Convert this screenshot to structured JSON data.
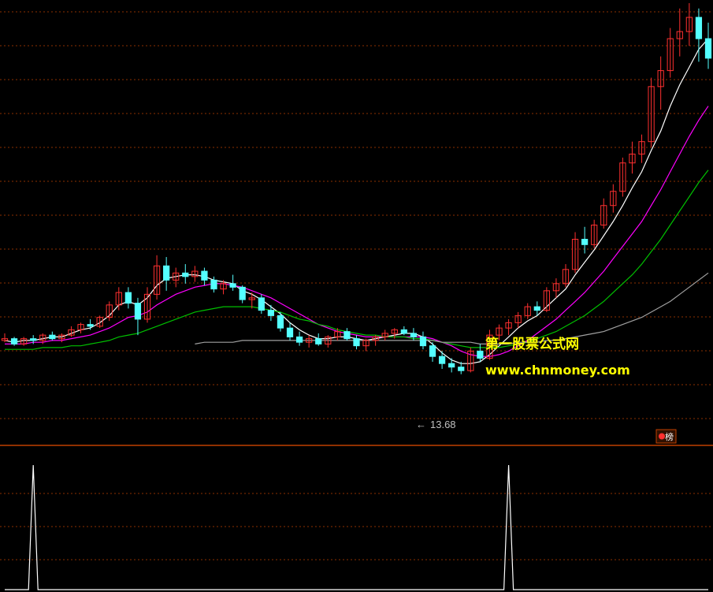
{
  "colors": {
    "background": "#000000",
    "grid": "#8b2f00",
    "divider": "#c04000",
    "up_candle": "#ff3030",
    "down_candle": "#54ffff",
    "ma_short": "#ffffff",
    "ma_mid": "#ff00ff",
    "ma_long": "#00c000",
    "ma_longest": "#a0a0a0",
    "indicator": "#ffffff",
    "watermark": "#ffff00"
  },
  "annotations": {
    "low_price": "13.68",
    "low_arrow": "←"
  },
  "watermark": {
    "line1": "第一股票公式网",
    "line2": "www.chnmoney.com"
  },
  "badge": {
    "icon": "list-badge-icon",
    "text": "榜"
  },
  "chart_data": [
    {
      "type": "candlestick",
      "panel": "main",
      "price_min_visible": 13.68,
      "candles": [
        [
          18.2,
          18.6,
          18.1,
          18.3
        ],
        [
          18.3,
          18.4,
          17.9,
          18.0
        ],
        [
          18.0,
          18.4,
          17.9,
          18.3
        ],
        [
          18.3,
          18.5,
          18.0,
          18.2
        ],
        [
          18.2,
          18.6,
          18.0,
          18.5
        ],
        [
          18.5,
          18.7,
          18.2,
          18.3
        ],
        [
          18.3,
          18.6,
          18.1,
          18.5
        ],
        [
          18.5,
          19.0,
          18.4,
          18.8
        ],
        [
          18.8,
          19.2,
          18.6,
          19.1
        ],
        [
          19.1,
          19.4,
          18.8,
          19.0
        ],
        [
          19.0,
          19.6,
          18.9,
          19.5
        ],
        [
          19.5,
          20.4,
          19.3,
          20.2
        ],
        [
          20.2,
          21.2,
          19.9,
          20.9
        ],
        [
          20.9,
          21.2,
          20.0,
          20.3
        ],
        [
          20.3,
          20.6,
          18.5,
          19.4
        ],
        [
          19.4,
          21.2,
          19.2,
          20.8
        ],
        [
          20.8,
          23.0,
          20.5,
          22.4
        ],
        [
          22.4,
          22.9,
          21.0,
          21.6
        ],
        [
          21.6,
          22.3,
          21.2,
          22.0
        ],
        [
          22.0,
          22.5,
          21.4,
          21.8
        ],
        [
          21.8,
          22.4,
          21.5,
          22.1
        ],
        [
          22.1,
          22.3,
          21.3,
          21.6
        ],
        [
          21.6,
          21.8,
          20.9,
          21.1
        ],
        [
          21.1,
          21.6,
          20.8,
          21.4
        ],
        [
          21.4,
          21.9,
          21.0,
          21.2
        ],
        [
          21.2,
          21.3,
          20.3,
          20.5
        ],
        [
          20.5,
          20.9,
          20.0,
          20.6
        ],
        [
          20.6,
          20.8,
          19.7,
          19.9
        ],
        [
          19.9,
          20.2,
          19.3,
          19.6
        ],
        [
          19.6,
          19.8,
          18.7,
          18.9
        ],
        [
          18.9,
          19.2,
          18.2,
          18.4
        ],
        [
          18.4,
          18.7,
          17.9,
          18.1
        ],
        [
          18.1,
          18.5,
          17.8,
          18.3
        ],
        [
          18.3,
          18.6,
          17.9,
          18.0
        ],
        [
          18.0,
          18.5,
          17.8,
          18.4
        ],
        [
          18.4,
          18.9,
          18.2,
          18.7
        ],
        [
          18.7,
          18.9,
          18.2,
          18.3
        ],
        [
          18.3,
          18.5,
          17.7,
          17.9
        ],
        [
          17.9,
          18.3,
          17.6,
          18.2
        ],
        [
          18.2,
          18.5,
          17.9,
          18.4
        ],
        [
          18.4,
          18.8,
          18.2,
          18.6
        ],
        [
          18.6,
          18.9,
          18.3,
          18.8
        ],
        [
          18.8,
          19.0,
          18.5,
          18.6
        ],
        [
          18.6,
          18.9,
          18.2,
          18.4
        ],
        [
          18.4,
          18.7,
          17.7,
          17.9
        ],
        [
          17.9,
          18.1,
          17.0,
          17.3
        ],
        [
          17.3,
          17.6,
          16.6,
          16.9
        ],
        [
          16.9,
          17.2,
          16.4,
          16.7
        ],
        [
          16.7,
          17.0,
          16.3,
          16.5
        ],
        [
          16.5,
          17.8,
          16.4,
          17.6
        ],
        [
          17.6,
          18.0,
          17.0,
          17.2
        ],
        [
          17.2,
          18.8,
          17.1,
          18.5
        ],
        [
          18.5,
          19.1,
          18.2,
          18.9
        ],
        [
          18.9,
          19.4,
          18.5,
          19.2
        ],
        [
          19.2,
          19.8,
          18.9,
          19.6
        ],
        [
          19.6,
          20.3,
          19.4,
          20.1
        ],
        [
          20.1,
          20.4,
          19.6,
          19.9
        ],
        [
          19.9,
          21.2,
          19.8,
          21.0
        ],
        [
          21.0,
          21.7,
          20.6,
          21.4
        ],
        [
          21.4,
          22.5,
          21.2,
          22.2
        ],
        [
          22.2,
          24.3,
          22.0,
          23.9
        ],
        [
          23.9,
          24.6,
          23.1,
          23.6
        ],
        [
          23.6,
          25.0,
          23.4,
          24.7
        ],
        [
          24.7,
          26.2,
          24.5,
          25.8
        ],
        [
          25.8,
          27.0,
          25.4,
          26.6
        ],
        [
          26.6,
          28.5,
          26.3,
          28.2
        ],
        [
          28.2,
          29.4,
          27.6,
          28.7
        ],
        [
          28.7,
          29.8,
          28.2,
          29.4
        ],
        [
          29.4,
          33.0,
          29.1,
          32.5
        ],
        [
          32.5,
          34.2,
          31.2,
          33.4
        ],
        [
          33.4,
          35.8,
          33.0,
          35.2
        ],
        [
          35.2,
          36.9,
          34.2,
          35.6
        ],
        [
          35.6,
          37.2,
          34.8,
          36.4
        ],
        [
          36.4,
          36.9,
          33.9,
          35.2
        ],
        [
          35.2,
          36.1,
          33.5,
          34.1
        ]
      ],
      "series": [
        {
          "name": "",
          "color": "#ffffff",
          "values": [
            18.2,
            18.1,
            18.2,
            18.2,
            18.3,
            18.4,
            18.4,
            18.6,
            18.8,
            18.9,
            19.2,
            19.6,
            20.2,
            20.4,
            20.2,
            20.6,
            21.3,
            21.7,
            21.8,
            21.9,
            21.9,
            21.8,
            21.6,
            21.5,
            21.4,
            21.0,
            20.8,
            20.5,
            20.1,
            19.7,
            19.2,
            18.8,
            18.5,
            18.3,
            18.3,
            18.4,
            18.4,
            18.3,
            18.2,
            18.3,
            18.4,
            18.5,
            18.6,
            18.6,
            18.4,
            18.0,
            17.5,
            17.1,
            16.9,
            16.9,
            17.0,
            17.4,
            17.9,
            18.4,
            18.9,
            19.3,
            19.6,
            20.1,
            20.6,
            21.1,
            21.9,
            22.6,
            23.3,
            24.1,
            24.9,
            25.8,
            26.8,
            27.7,
            28.9,
            30.0,
            31.4,
            32.6,
            33.6,
            34.6,
            35.2
          ]
        },
        {
          "name": "",
          "color": "#ff00ff",
          "values": [
            18.0,
            18.0,
            18.0,
            18.1,
            18.1,
            18.2,
            18.2,
            18.3,
            18.4,
            18.5,
            18.7,
            18.9,
            19.2,
            19.5,
            19.6,
            19.8,
            20.2,
            20.5,
            20.8,
            21.0,
            21.2,
            21.3,
            21.4,
            21.4,
            21.3,
            21.2,
            21.0,
            20.8,
            20.6,
            20.3,
            20.0,
            19.7,
            19.4,
            19.1,
            18.9,
            18.7,
            18.6,
            18.5,
            18.4,
            18.4,
            18.4,
            18.4,
            18.4,
            18.4,
            18.4,
            18.3,
            18.1,
            17.9,
            17.6,
            17.4,
            17.3,
            17.3,
            17.4,
            17.6,
            17.9,
            18.2,
            18.6,
            19.0,
            19.4,
            19.9,
            20.4,
            20.9,
            21.5,
            22.1,
            22.8,
            23.5,
            24.2,
            24.9,
            25.8,
            26.7,
            27.7,
            28.7,
            29.7,
            30.6,
            31.4
          ]
        },
        {
          "name": "",
          "color": "#00c000",
          "values": [
            17.7,
            17.7,
            17.7,
            17.7,
            17.8,
            17.8,
            17.8,
            17.9,
            17.9,
            18.0,
            18.1,
            18.2,
            18.4,
            18.5,
            18.6,
            18.8,
            19.0,
            19.2,
            19.4,
            19.6,
            19.8,
            19.9,
            20.0,
            20.1,
            20.1,
            20.1,
            20.1,
            20.0,
            19.9,
            19.8,
            19.6,
            19.4,
            19.3,
            19.1,
            19.0,
            18.8,
            18.7,
            18.6,
            18.5,
            18.5,
            18.4,
            18.4,
            18.4,
            18.3,
            18.3,
            18.2,
            18.1,
            18.0,
            17.9,
            17.8,
            17.8,
            17.8,
            17.8,
            17.9,
            18.0,
            18.1,
            18.3,
            18.5,
            18.7,
            19.0,
            19.3,
            19.6,
            20.0,
            20.4,
            20.9,
            21.4,
            21.9,
            22.5,
            23.2,
            23.9,
            24.7,
            25.5,
            26.3,
            27.1,
            27.8
          ]
        },
        {
          "name": "",
          "color": "#a0a0a0",
          "values": [
            null,
            null,
            null,
            null,
            null,
            null,
            null,
            null,
            null,
            null,
            null,
            null,
            null,
            null,
            null,
            null,
            null,
            null,
            null,
            null,
            18.0,
            18.1,
            18.1,
            18.1,
            18.1,
            18.2,
            18.2,
            18.2,
            18.2,
            18.2,
            18.2,
            18.2,
            18.2,
            18.2,
            18.2,
            18.2,
            18.2,
            18.2,
            18.2,
            18.2,
            18.2,
            18.2,
            18.2,
            18.2,
            18.2,
            18.2,
            18.1,
            18.1,
            18.1,
            18.1,
            18.0,
            18.0,
            18.0,
            18.0,
            18.1,
            18.1,
            18.1,
            18.2,
            18.2,
            18.3,
            18.4,
            18.5,
            18.6,
            18.7,
            18.9,
            19.1,
            19.3,
            19.5,
            19.8,
            20.1,
            20.4,
            20.8,
            21.2,
            21.6,
            22.0
          ]
        }
      ]
    },
    {
      "type": "line",
      "panel": "indicator",
      "series": [
        {
          "name": "",
          "color": "#ffffff",
          "spikes_at": [
            3,
            53
          ],
          "values": [
            0,
            0,
            0,
            1,
            0,
            0,
            0,
            0,
            0,
            0,
            0,
            0,
            0,
            0,
            0,
            0,
            0,
            0,
            0,
            0,
            0,
            0,
            0,
            0,
            0,
            0,
            0,
            0,
            0,
            0,
            0,
            0,
            0,
            0,
            0,
            0,
            0,
            0,
            0,
            0,
            0,
            0,
            0,
            0,
            0,
            0,
            0,
            0,
            0,
            0,
            0,
            0,
            0,
            1,
            0,
            0,
            0,
            0,
            0,
            0,
            0,
            0,
            0,
            0,
            0,
            0,
            0,
            0,
            0,
            0,
            0,
            0,
            0,
            0,
            0
          ]
        }
      ]
    }
  ]
}
